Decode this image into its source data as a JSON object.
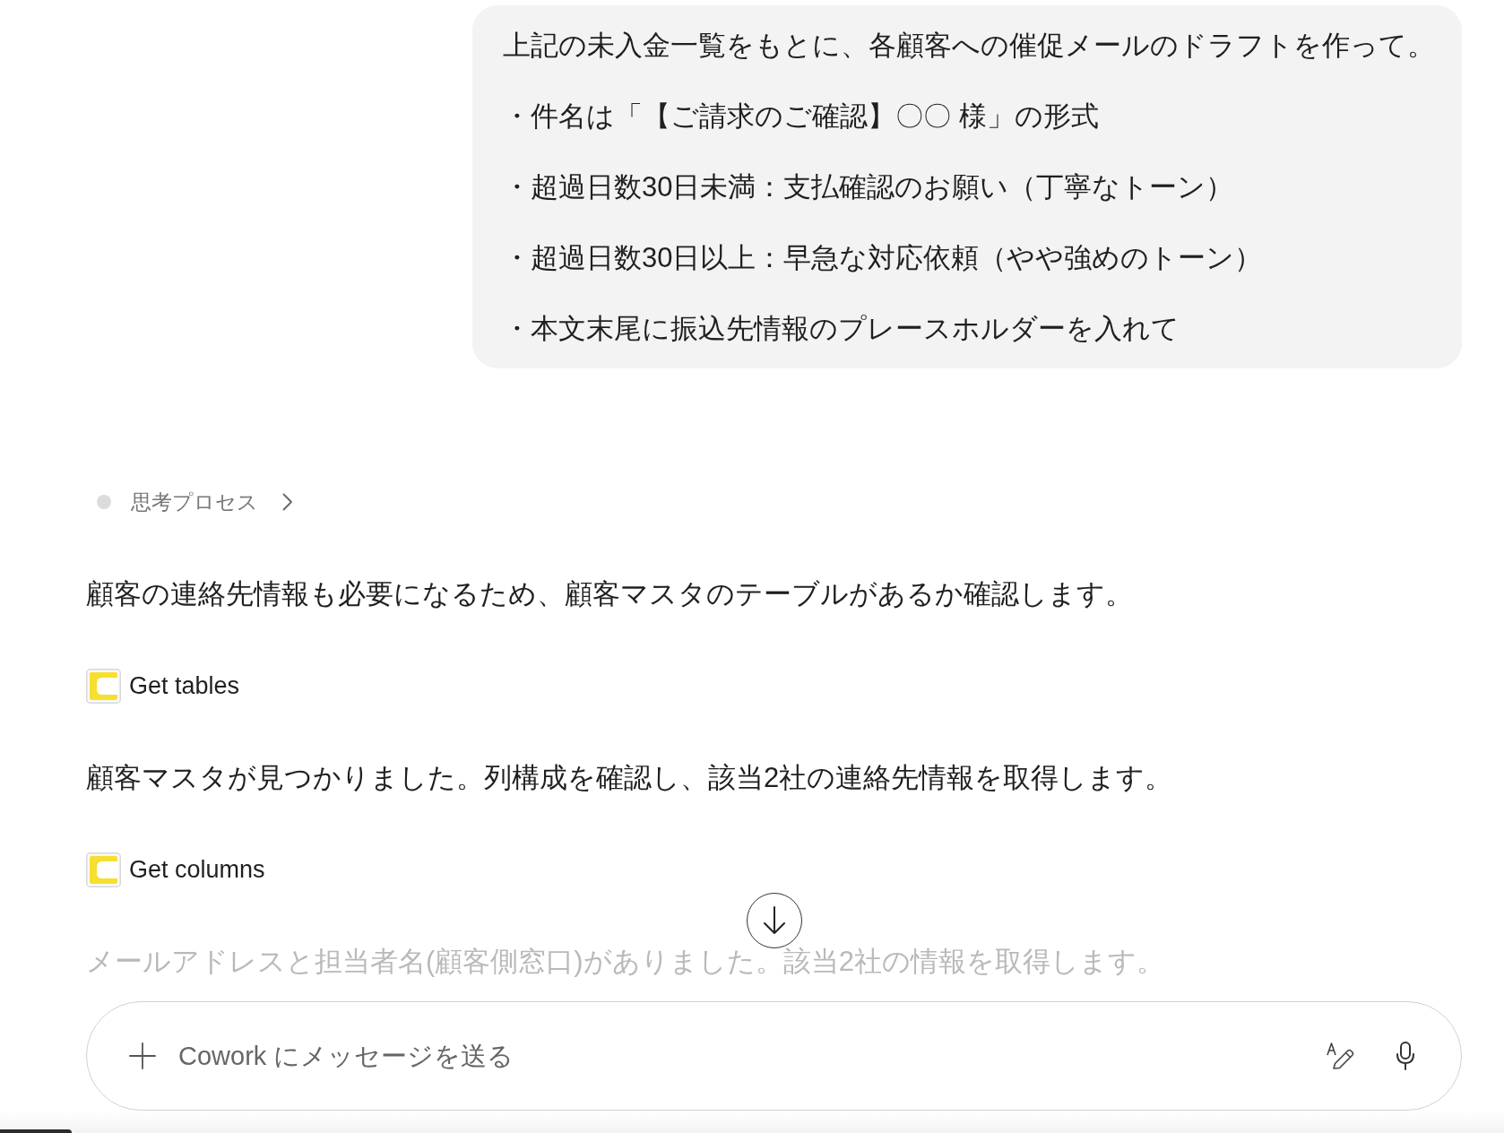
{
  "user_message": {
    "lines": [
      "上記の未入金一覧をもとに、各顧客への催促メールのドラフトを作って。",
      "・件名は「【ご請求のご確認】〇〇 様」の形式",
      "・超過日数30日未満：支払確認のお願い（丁寧なトーン）",
      "・超過日数30日以上：早急な対応依頼（やや強めのトーン）",
      "・本文末尾に振込先情報のプレースホルダーを入れて"
    ]
  },
  "thinking": {
    "label": "思考プロセス",
    "expanded": false
  },
  "messages": [
    {
      "kind": "text",
      "text": "顧客の連絡先情報も必要になるため、顧客マスタのテーブルがあるか確認します。",
      "faded": false
    },
    {
      "kind": "tool",
      "label": "Get tables"
    },
    {
      "kind": "text",
      "text": "顧客マスタが見つかりました。列構成を確認し、該当2社の連絡先情報を取得します。",
      "faded": false
    },
    {
      "kind": "tool",
      "label": "Get columns"
    },
    {
      "kind": "text",
      "text": "メールアドレスと担当者名(顧客側窓口)がありました。該当2社の情報を取得します。",
      "faded": true
    }
  ],
  "composer": {
    "placeholder": "Cowork にメッセージを送る"
  }
}
